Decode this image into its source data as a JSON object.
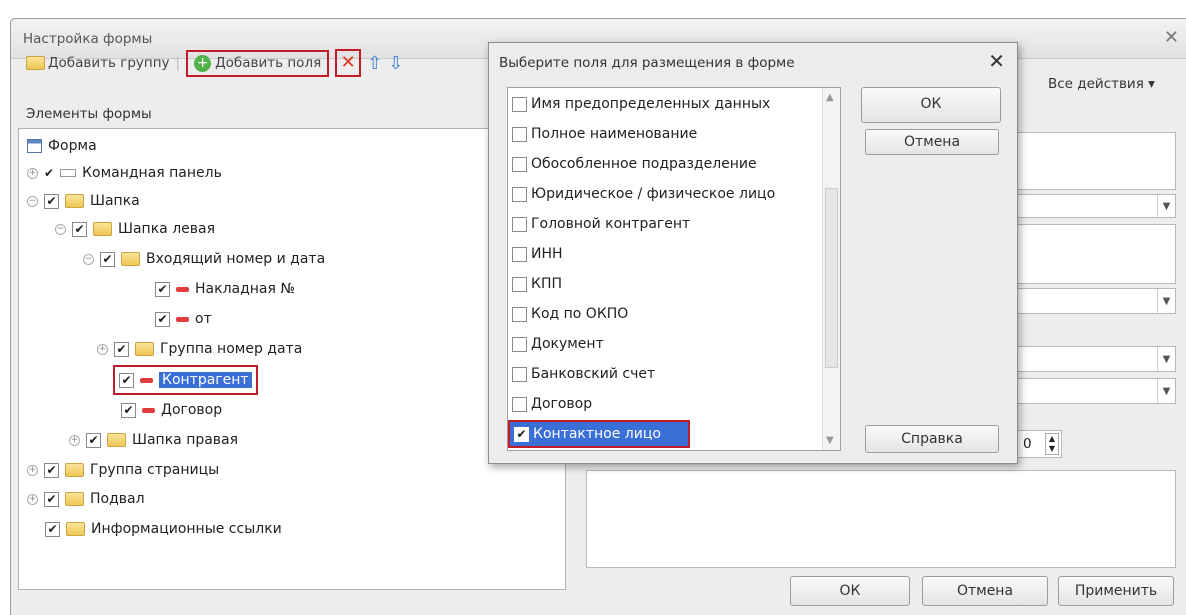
{
  "window": {
    "title": "Настройка формы",
    "close": "✕"
  },
  "toolbar": {
    "add_group": "Добавить группу",
    "add_fields": "Добавить поля",
    "delete": "✕",
    "up": "⇧",
    "down": "⇩",
    "all_actions": "Все действия ▾"
  },
  "tree": {
    "header": "Элементы формы",
    "items": [
      {
        "label": "Форма"
      },
      {
        "label": "Командная панель"
      },
      {
        "label": "Шапка"
      },
      {
        "label": "Шапка левая"
      },
      {
        "label": "Входящий номер и дата"
      },
      {
        "label": "Накладная №"
      },
      {
        "label": "от"
      },
      {
        "label": "Группа номер дата"
      },
      {
        "label": "Контрагент"
      },
      {
        "label": "Договор"
      },
      {
        "label": "Шапка правая"
      },
      {
        "label": "Группа страницы"
      },
      {
        "label": "Подвал"
      },
      {
        "label": "Информационные ссылки"
      }
    ]
  },
  "dialog": {
    "title": "Выберите поля для размещения в форме",
    "close": "✕",
    "ok": "ОК",
    "cancel": "Отмена",
    "help": "Справка",
    "fields": [
      {
        "label": "Имя предопределенных данных"
      },
      {
        "label": "Полное наименование"
      },
      {
        "label": "Обособленное подразделение"
      },
      {
        "label": "Юридическое / физическое лицо"
      },
      {
        "label": "Головной контрагент"
      },
      {
        "label": "ИНН"
      },
      {
        "label": "КПП"
      },
      {
        "label": "Код по ОКПО"
      },
      {
        "label": "Документ"
      },
      {
        "label": "Банковский счет"
      },
      {
        "label": "Договор"
      },
      {
        "label": "Контактное лицо"
      }
    ]
  },
  "props": {
    "spin_value": "0"
  },
  "footer": {
    "ok": "ОК",
    "cancel": "Отмена",
    "apply": "Применить"
  }
}
